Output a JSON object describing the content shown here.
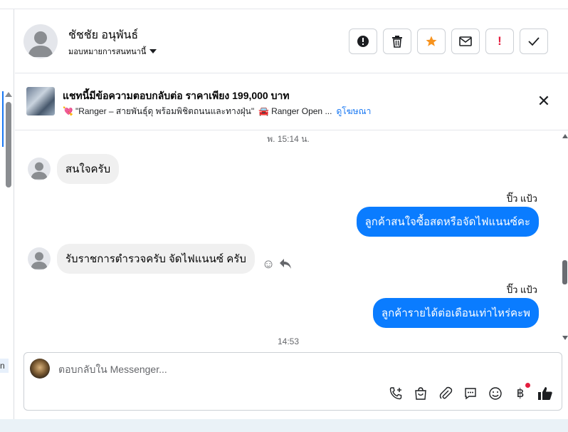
{
  "contact": {
    "name": "ชัชชัย อนุพันธ์",
    "assign_label": "มอบหมายการสนทนานี้"
  },
  "actions": [
    {
      "name": "alert-circle-icon",
      "glyph": "❗"
    },
    {
      "name": "trash-icon",
      "glyph": "🗑"
    },
    {
      "name": "star-icon",
      "glyph": "★"
    },
    {
      "name": "mail-icon",
      "glyph": "✉"
    },
    {
      "name": "exclamation-icon",
      "glyph": "!"
    },
    {
      "name": "check-icon",
      "glyph": "✓"
    }
  ],
  "ad_banner": {
    "title": "แชทนี้มีข้อความตอบกลับต่อ ราคาเพียง 199,000 บาท",
    "subtitle": "\"Ranger – สายพันธุ์ดุ พร้อมพิชิตถนนและทางฝุ่น\"",
    "subtitle_suffix": "Ranger Open ...",
    "link": "ดูโฆษณา",
    "close_glyph": "✕"
  },
  "conversation": {
    "timestamp_top": "พ. 15:14 น.",
    "messages": [
      {
        "direction": "in",
        "text": "สนใจครับ"
      },
      {
        "direction": "out",
        "sender": "ปิ๊ว แป้ว",
        "text": "ลูกค้าสนใจซื้อสดหรือจัดไฟแนนซ์คะ"
      },
      {
        "direction": "in",
        "text": "รับราชการตำรวจครับ จัดไฟแนนซ์ ครับ"
      },
      {
        "direction": "out",
        "sender": "ปิ๊ว แป้ว",
        "text": "ลูกค้ารายได้ต่อเดือนเท่าไหร่คะพ"
      }
    ],
    "timestamp_bottom": "14:53"
  },
  "composer": {
    "placeholder": "ตอบกลับใน Messenger..."
  },
  "colors": {
    "accent": "#0a7cff",
    "link": "#1877f2",
    "star": "#f7931e",
    "danger": "#e41e3f"
  },
  "left_fragment": "n"
}
